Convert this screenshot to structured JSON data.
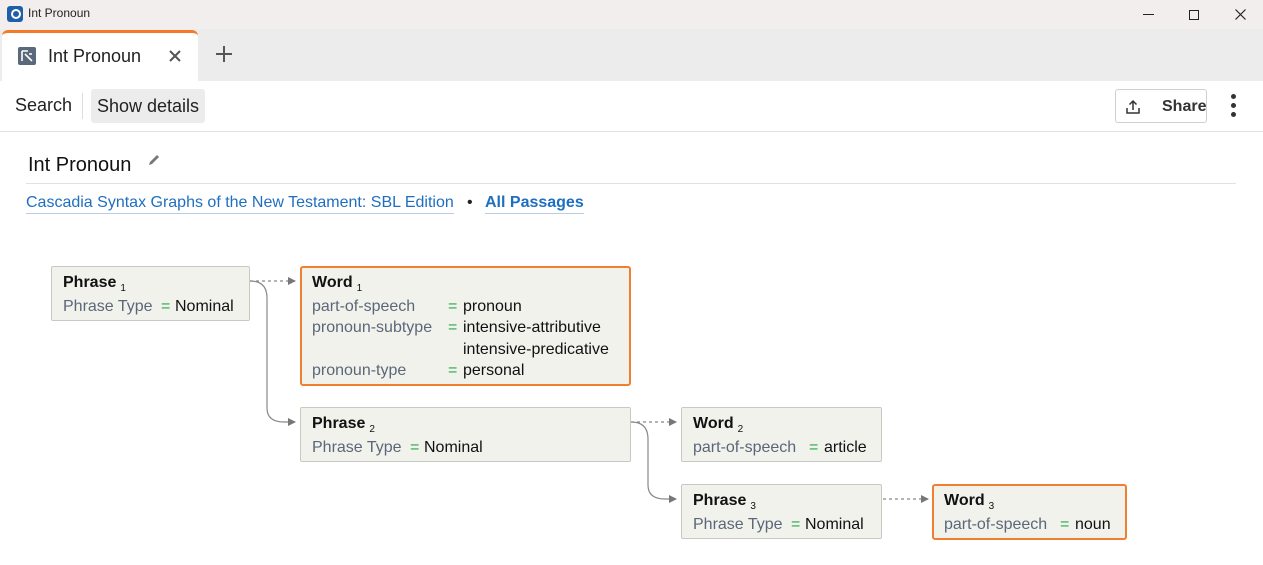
{
  "window": {
    "title": "Int Pronoun"
  },
  "tabs": [
    {
      "label": "Int Pronoun"
    }
  ],
  "toolbar": {
    "search_label": "Search",
    "details_label": "Show details",
    "share_label": "Share"
  },
  "document": {
    "title": "Int Pronoun",
    "source": "Cascadia Syntax Graphs of the New Testament: SBL Edition",
    "separator": "•",
    "passages": "All Passages"
  },
  "graph": {
    "nodes": {
      "phrase1": {
        "title": "Phrase",
        "index": "1",
        "rows": [
          {
            "key": "Phrase Type",
            "eq": "=",
            "val": "Nominal"
          }
        ]
      },
      "word1": {
        "title": "Word",
        "index": "1",
        "rows": [
          {
            "key": "part-of-speech",
            "eq": "=",
            "val": "pronoun"
          },
          {
            "key": "pronoun-subtype",
            "eq": "=",
            "val": "intensive-attributive"
          },
          {
            "key": "",
            "eq": "",
            "val": "intensive-predicative"
          },
          {
            "key": "pronoun-type",
            "eq": "=",
            "val": "personal"
          }
        ]
      },
      "phrase2": {
        "title": "Phrase",
        "index": "2",
        "rows": [
          {
            "key": "Phrase Type",
            "eq": "=",
            "val": "Nominal"
          }
        ]
      },
      "word2": {
        "title": "Word",
        "index": "2",
        "rows": [
          {
            "key": "part-of-speech",
            "eq": "=",
            "val": "article"
          }
        ]
      },
      "phrase3": {
        "title": "Phrase",
        "index": "3",
        "rows": [
          {
            "key": "Phrase Type",
            "eq": "=",
            "val": "Nominal"
          }
        ]
      },
      "word3": {
        "title": "Word",
        "index": "3",
        "rows": [
          {
            "key": "part-of-speech",
            "eq": "=",
            "val": "noun"
          }
        ]
      }
    }
  },
  "colors": {
    "accent": "#f47a28",
    "link": "#1f6fc0",
    "equals": "#2aa84a",
    "node_bg": "#f2f2ed"
  },
  "icons": {
    "app": "app-logo-icon",
    "tab": "syntax-search-icon",
    "close": "close-icon",
    "add": "plus-icon",
    "edit": "pencil-icon",
    "share": "share-upload-icon",
    "more": "kebab-menu-icon"
  }
}
